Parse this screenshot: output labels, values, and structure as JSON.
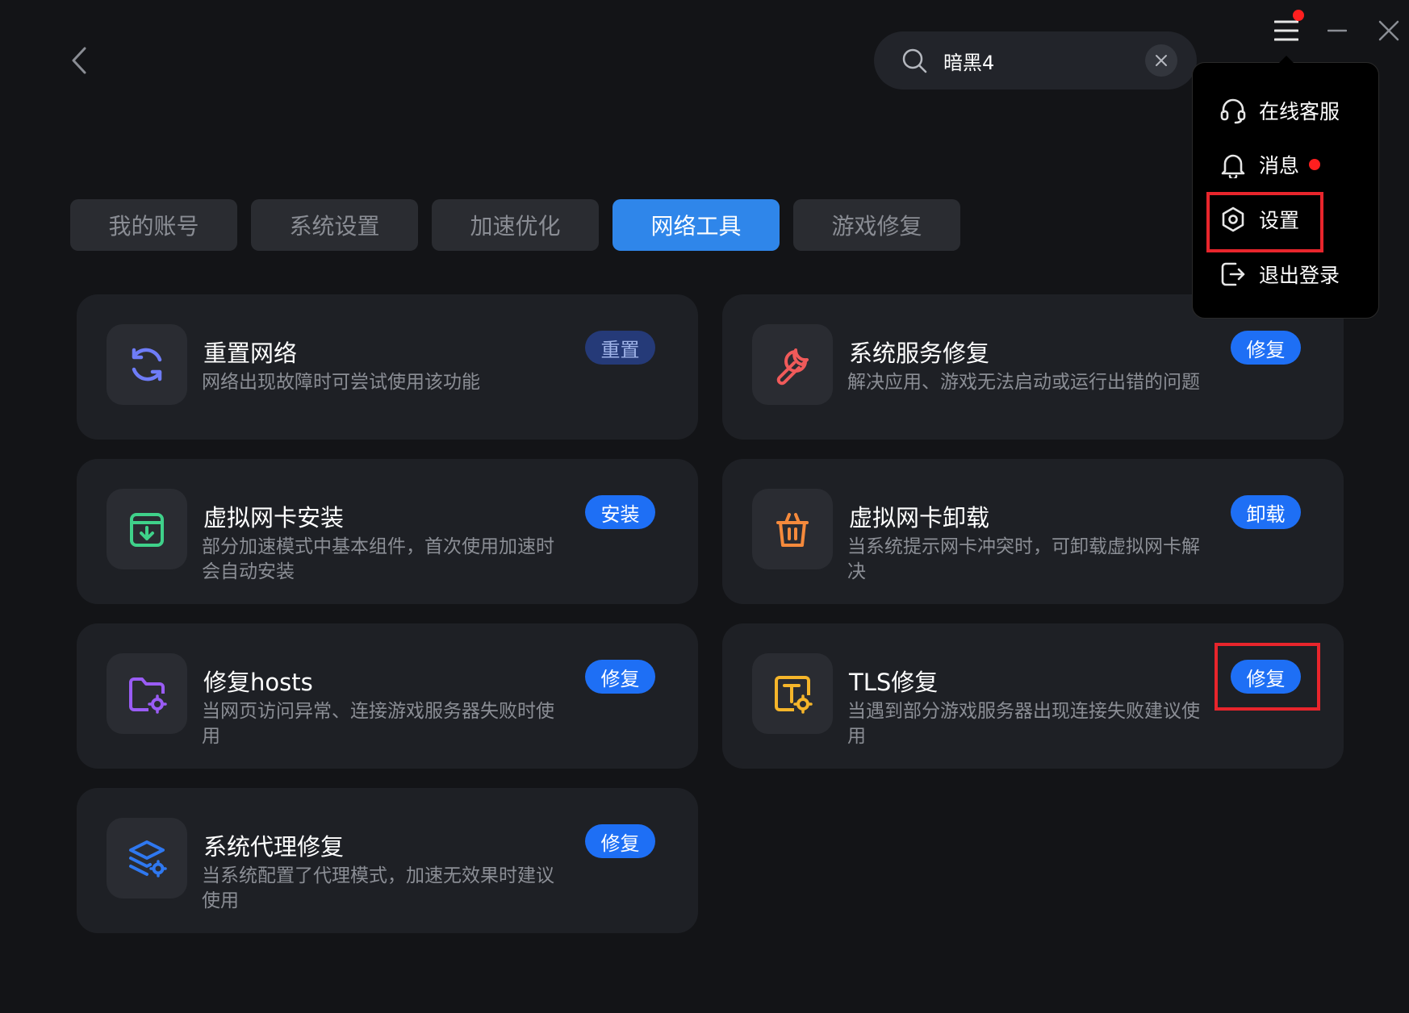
{
  "search": {
    "value": "暗黑4"
  },
  "tabs": [
    {
      "label": "我的账号",
      "active": false
    },
    {
      "label": "系统设置",
      "active": false
    },
    {
      "label": "加速优化",
      "active": false
    },
    {
      "label": "网络工具",
      "active": true
    },
    {
      "label": "游戏修复",
      "active": false
    }
  ],
  "cards": [
    {
      "title": "重置网络",
      "desc": "网络出现故障时可尝试使用该功能",
      "action": "重置",
      "icon": "refresh-icon"
    },
    {
      "title": "系统服务修复",
      "desc": "解决应用、游戏无法启动或运行出错的问题",
      "action": "修复",
      "icon": "wrench-icon"
    },
    {
      "title": "虚拟网卡安装",
      "desc": "部分加速模式中基本组件，首次使用加速时会自动安装",
      "action": "安装",
      "icon": "download-box-icon"
    },
    {
      "title": "虚拟网卡卸载",
      "desc": "当系统提示网卡冲突时，可卸载虚拟网卡解决",
      "action": "卸载",
      "icon": "trash-icon"
    },
    {
      "title": "修复hosts",
      "desc": "当网页访问异常、连接游戏服务器失败时使用",
      "action": "修复",
      "icon": "folder-gear-icon"
    },
    {
      "title": "TLS修复",
      "desc": "当遇到部分游戏服务器出现连接失败建议使用",
      "action": "修复",
      "icon": "text-gear-icon"
    },
    {
      "title": "系统代理修复",
      "desc": "当系统配置了代理模式，加速无效果时建议使用",
      "action": "修复",
      "icon": "layers-gear-icon"
    }
  ],
  "menu": {
    "items": [
      {
        "label": "在线客服",
        "icon": "headset-icon"
      },
      {
        "label": "消息",
        "icon": "bell-icon"
      },
      {
        "label": "设置",
        "icon": "settings-hex-icon"
      },
      {
        "label": "退出登录",
        "icon": "logout-icon"
      }
    ]
  },
  "colors": {
    "accent": "#1e6ff5",
    "tab_active": "#2f86ea",
    "highlight": "#e8252c",
    "notification": "#ff1f1f"
  }
}
